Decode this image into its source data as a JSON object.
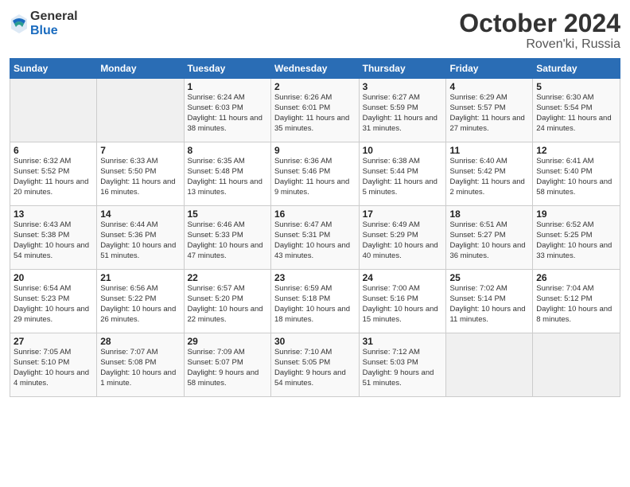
{
  "logo": {
    "general": "General",
    "blue": "Blue"
  },
  "title": "October 2024",
  "location": "Roven'ki, Russia",
  "days_header": [
    "Sunday",
    "Monday",
    "Tuesday",
    "Wednesday",
    "Thursday",
    "Friday",
    "Saturday"
  ],
  "weeks": [
    [
      {
        "day": "",
        "content": ""
      },
      {
        "day": "",
        "content": ""
      },
      {
        "day": "1",
        "content": "Sunrise: 6:24 AM\nSunset: 6:03 PM\nDaylight: 11 hours\nand 38 minutes."
      },
      {
        "day": "2",
        "content": "Sunrise: 6:26 AM\nSunset: 6:01 PM\nDaylight: 11 hours\nand 35 minutes."
      },
      {
        "day": "3",
        "content": "Sunrise: 6:27 AM\nSunset: 5:59 PM\nDaylight: 11 hours\nand 31 minutes."
      },
      {
        "day": "4",
        "content": "Sunrise: 6:29 AM\nSunset: 5:57 PM\nDaylight: 11 hours\nand 27 minutes."
      },
      {
        "day": "5",
        "content": "Sunrise: 6:30 AM\nSunset: 5:54 PM\nDaylight: 11 hours\nand 24 minutes."
      }
    ],
    [
      {
        "day": "6",
        "content": "Sunrise: 6:32 AM\nSunset: 5:52 PM\nDaylight: 11 hours\nand 20 minutes."
      },
      {
        "day": "7",
        "content": "Sunrise: 6:33 AM\nSunset: 5:50 PM\nDaylight: 11 hours\nand 16 minutes."
      },
      {
        "day": "8",
        "content": "Sunrise: 6:35 AM\nSunset: 5:48 PM\nDaylight: 11 hours\nand 13 minutes."
      },
      {
        "day": "9",
        "content": "Sunrise: 6:36 AM\nSunset: 5:46 PM\nDaylight: 11 hours\nand 9 minutes."
      },
      {
        "day": "10",
        "content": "Sunrise: 6:38 AM\nSunset: 5:44 PM\nDaylight: 11 hours\nand 5 minutes."
      },
      {
        "day": "11",
        "content": "Sunrise: 6:40 AM\nSunset: 5:42 PM\nDaylight: 11 hours\nand 2 minutes."
      },
      {
        "day": "12",
        "content": "Sunrise: 6:41 AM\nSunset: 5:40 PM\nDaylight: 10 hours\nand 58 minutes."
      }
    ],
    [
      {
        "day": "13",
        "content": "Sunrise: 6:43 AM\nSunset: 5:38 PM\nDaylight: 10 hours\nand 54 minutes."
      },
      {
        "day": "14",
        "content": "Sunrise: 6:44 AM\nSunset: 5:36 PM\nDaylight: 10 hours\nand 51 minutes."
      },
      {
        "day": "15",
        "content": "Sunrise: 6:46 AM\nSunset: 5:33 PM\nDaylight: 10 hours\nand 47 minutes."
      },
      {
        "day": "16",
        "content": "Sunrise: 6:47 AM\nSunset: 5:31 PM\nDaylight: 10 hours\nand 43 minutes."
      },
      {
        "day": "17",
        "content": "Sunrise: 6:49 AM\nSunset: 5:29 PM\nDaylight: 10 hours\nand 40 minutes."
      },
      {
        "day": "18",
        "content": "Sunrise: 6:51 AM\nSunset: 5:27 PM\nDaylight: 10 hours\nand 36 minutes."
      },
      {
        "day": "19",
        "content": "Sunrise: 6:52 AM\nSunset: 5:25 PM\nDaylight: 10 hours\nand 33 minutes."
      }
    ],
    [
      {
        "day": "20",
        "content": "Sunrise: 6:54 AM\nSunset: 5:23 PM\nDaylight: 10 hours\nand 29 minutes."
      },
      {
        "day": "21",
        "content": "Sunrise: 6:56 AM\nSunset: 5:22 PM\nDaylight: 10 hours\nand 26 minutes."
      },
      {
        "day": "22",
        "content": "Sunrise: 6:57 AM\nSunset: 5:20 PM\nDaylight: 10 hours\nand 22 minutes."
      },
      {
        "day": "23",
        "content": "Sunrise: 6:59 AM\nSunset: 5:18 PM\nDaylight: 10 hours\nand 18 minutes."
      },
      {
        "day": "24",
        "content": "Sunrise: 7:00 AM\nSunset: 5:16 PM\nDaylight: 10 hours\nand 15 minutes."
      },
      {
        "day": "25",
        "content": "Sunrise: 7:02 AM\nSunset: 5:14 PM\nDaylight: 10 hours\nand 11 minutes."
      },
      {
        "day": "26",
        "content": "Sunrise: 7:04 AM\nSunset: 5:12 PM\nDaylight: 10 hours\nand 8 minutes."
      }
    ],
    [
      {
        "day": "27",
        "content": "Sunrise: 7:05 AM\nSunset: 5:10 PM\nDaylight: 10 hours\nand 4 minutes."
      },
      {
        "day": "28",
        "content": "Sunrise: 7:07 AM\nSunset: 5:08 PM\nDaylight: 10 hours\nand 1 minute."
      },
      {
        "day": "29",
        "content": "Sunrise: 7:09 AM\nSunset: 5:07 PM\nDaylight: 9 hours\nand 58 minutes."
      },
      {
        "day": "30",
        "content": "Sunrise: 7:10 AM\nSunset: 5:05 PM\nDaylight: 9 hours\nand 54 minutes."
      },
      {
        "day": "31",
        "content": "Sunrise: 7:12 AM\nSunset: 5:03 PM\nDaylight: 9 hours\nand 51 minutes."
      },
      {
        "day": "",
        "content": ""
      },
      {
        "day": "",
        "content": ""
      }
    ]
  ]
}
